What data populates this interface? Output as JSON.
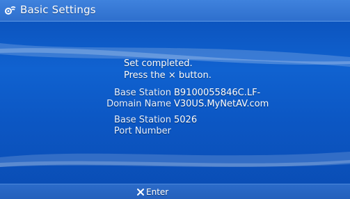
{
  "header": {
    "title": "Basic Settings",
    "icon": "network-settings-icon"
  },
  "message": {
    "line1": "Set completed.",
    "line2": "Press the × button."
  },
  "fields": [
    {
      "label_line1": "Base Station",
      "label_line2": "Domain Name",
      "value_line1": "B9100055846C.LF-",
      "value_line2": "V30US.MyNetAV.com"
    },
    {
      "label_line1": "Base Station",
      "label_line2": "Port Number",
      "value_line1": "5026"
    }
  ],
  "footer": {
    "enter_icon": "cross-button-icon",
    "enter_label": "Enter"
  },
  "colors": {
    "background": "#0c57c4",
    "header_bar": "#2e6fcd",
    "text": "#ffffff"
  }
}
